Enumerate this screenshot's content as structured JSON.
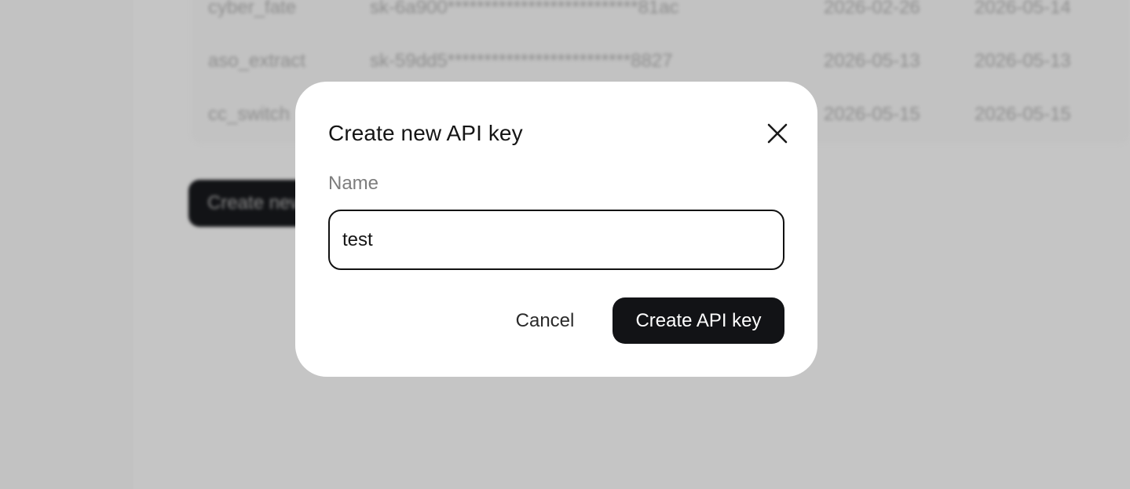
{
  "background": {
    "table_rows": [
      {
        "name": "cyber_fate",
        "key": "sk-6a900**************************81ac",
        "created": "2026-02-26",
        "last_used": "2026-05-14"
      },
      {
        "name": "aso_extract",
        "key": "sk-59dd5*************************8827",
        "created": "2026-05-13",
        "last_used": "2026-05-13"
      },
      {
        "name": "cc_switch",
        "key": "",
        "created": "2026-05-15",
        "last_used": "2026-05-15"
      }
    ],
    "create_button_label": "Create new"
  },
  "modal": {
    "title": "Create new API key",
    "close_icon": "close-icon",
    "name_label": "Name",
    "name_value": "test",
    "cancel_label": "Cancel",
    "submit_label": "Create API key"
  },
  "colors": {
    "overlay": "#c4c4c4",
    "primary_button": "#121316",
    "modal_background": "#ffffff"
  }
}
